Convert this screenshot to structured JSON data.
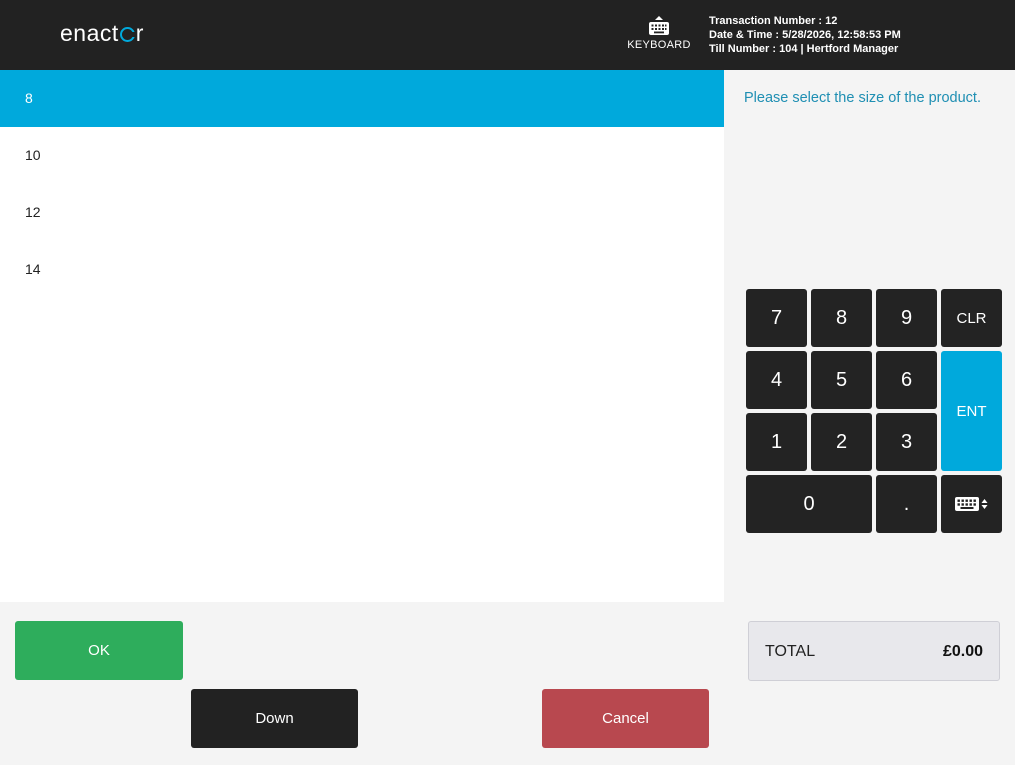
{
  "header": {
    "logo_text": "enactor",
    "keyboard_label": "KEYBOARD",
    "transaction_number": "Transaction Number : 12",
    "date_time": "Date & Time : 5/28/2026, 12:58:53 PM",
    "till_number": "Till Number : 104  |  Hertford Manager"
  },
  "size_list": {
    "items": [
      "8",
      "10",
      "12",
      "14"
    ],
    "selected_index": 0
  },
  "prompt": "Please select the size of the product.",
  "keypad": {
    "keys": [
      "7",
      "8",
      "9",
      "CLR",
      "4",
      "5",
      "6",
      "ENT",
      "1",
      "2",
      "3",
      "0",
      "."
    ],
    "keyboard_toggle_icon": "keyboard-toggle-icon"
  },
  "buttons": {
    "ok": "OK",
    "down": "Down",
    "cancel": "Cancel"
  },
  "total": {
    "label": "TOTAL",
    "value": "£0.00"
  },
  "colors": {
    "accent": "#00a9dc",
    "ok": "#2ead5c",
    "cancel": "#b8484f",
    "dark": "#222222"
  }
}
